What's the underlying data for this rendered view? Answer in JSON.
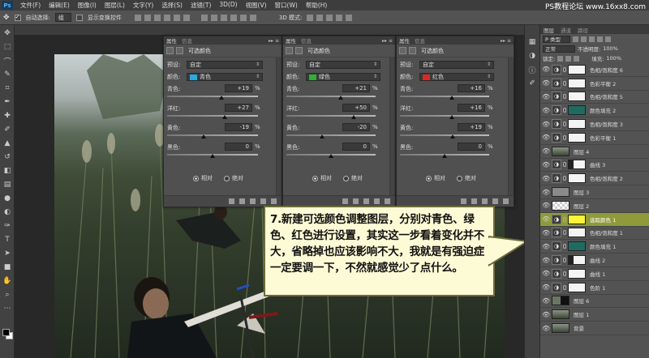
{
  "watermark": "PS教程论坛 www.16xx8.com",
  "menu": [
    "文件(F)",
    "编辑(E)",
    "图像(I)",
    "图层(L)",
    "文字(Y)",
    "选择(S)",
    "滤镜(T)",
    "3D(D)",
    "视图(V)",
    "窗口(W)",
    "帮助(H)"
  ],
  "options": {
    "auto_select_label": "自动选择:",
    "auto_select_value": "组",
    "transform_label": "显示变换控件",
    "mode_3d": "3D 模式:"
  },
  "panels": [
    {
      "tab_props": "属性",
      "tab_info": "信息",
      "title": "可选颜色",
      "preset_label": "预设:",
      "preset_value": "自定",
      "color_label": "颜色:",
      "color_value": "青色",
      "color_swatch": "#29a9e0",
      "sliders": [
        {
          "label": "青色:",
          "value": "+19",
          "level": 19
        },
        {
          "label": "洋红:",
          "value": "+27",
          "level": 27
        },
        {
          "label": "黄色:",
          "value": "-19",
          "level": -19
        },
        {
          "label": "黑色:",
          "value": "0",
          "level": 0
        }
      ],
      "pct": "%",
      "radio_relative": "相对",
      "radio_absolute": "绝对"
    },
    {
      "tab_props": "属性",
      "tab_info": "信息",
      "title": "可选颜色",
      "preset_label": "预设:",
      "preset_value": "自定",
      "color_label": "颜色:",
      "color_value": "绿色",
      "color_swatch": "#2db12f",
      "sliders": [
        {
          "label": "青色:",
          "value": "+21",
          "level": 21
        },
        {
          "label": "洋红:",
          "value": "+50",
          "level": 50
        },
        {
          "label": "黄色:",
          "value": "-20",
          "level": -20
        },
        {
          "label": "黑色:",
          "value": "0",
          "level": 0
        }
      ],
      "pct": "%",
      "radio_relative": "相对",
      "radio_absolute": "绝对"
    },
    {
      "tab_props": "属性",
      "tab_info": "信息",
      "title": "可选颜色",
      "preset_label": "预设:",
      "preset_value": "自定",
      "color_label": "颜色:",
      "color_value": "红色",
      "color_swatch": "#e0261f",
      "sliders": [
        {
          "label": "青色:",
          "value": "+16",
          "level": 16
        },
        {
          "label": "洋红:",
          "value": "+16",
          "level": 16
        },
        {
          "label": "黄色:",
          "value": "+19",
          "level": 19
        },
        {
          "label": "黑色:",
          "value": "0",
          "level": 0
        }
      ],
      "pct": "%",
      "radio_relative": "相对",
      "radio_absolute": "绝对"
    }
  ],
  "callout": "7.新建可选颜色调整图层，分别对青色、绿色、红色进行设置，其实这一步看着变化并不大，省略掉也应该影响不大，我就是有强迫症一定要调一下，不然就感觉少了点什么。",
  "layers_panel": {
    "tabs": [
      "图层",
      "通道",
      "路径"
    ],
    "kind_label": "P 类型",
    "blend_mode": "正常",
    "opacity_label": "不透明度:",
    "opacity_value": "100%",
    "lock_label": "锁定:",
    "fill_label": "填充:",
    "fill_value": "100%",
    "layers": [
      {
        "name": "色相/饱和度 6",
        "thumb": "mask",
        "active": false
      },
      {
        "name": "色彩平衡 2",
        "thumb": "mask",
        "active": false
      },
      {
        "name": "色相/饱和度 5",
        "thumb": "mask",
        "active": false
      },
      {
        "name": "颜色填充 2",
        "thumb": "teal",
        "active": false
      },
      {
        "name": "色相/饱和度 3",
        "thumb": "mask",
        "active": false
      },
      {
        "name": "色彩平衡 1",
        "thumb": "mask",
        "active": false
      },
      {
        "name": "图层 4",
        "thumb": "photo",
        "active": false
      },
      {
        "name": "曲线 3",
        "thumb": "mask-dark",
        "active": false
      },
      {
        "name": "色相/饱和度 2",
        "thumb": "mask",
        "active": false
      },
      {
        "name": "图层 3",
        "thumb": "gray",
        "active": false
      },
      {
        "name": "图层 2",
        "thumb": "checker",
        "active": false
      },
      {
        "name": "选取颜色 1",
        "thumb": "yellow",
        "active": true
      },
      {
        "name": "色相/饱和度 1",
        "thumb": "mask",
        "active": false
      },
      {
        "name": "颜色填充 1",
        "thumb": "teal",
        "active": false
      },
      {
        "name": "曲线 2",
        "thumb": "mask-dark",
        "active": false
      },
      {
        "name": "曲线 1",
        "thumb": "mask",
        "active": false
      },
      {
        "name": "色阶 1",
        "thumb": "mask",
        "active": false
      },
      {
        "name": "图层 6",
        "thumb": "photo-mask",
        "active": false
      },
      {
        "name": "图层 1",
        "thumb": "photo",
        "active": false
      },
      {
        "name": "背景",
        "thumb": "photo",
        "active": false
      }
    ]
  }
}
